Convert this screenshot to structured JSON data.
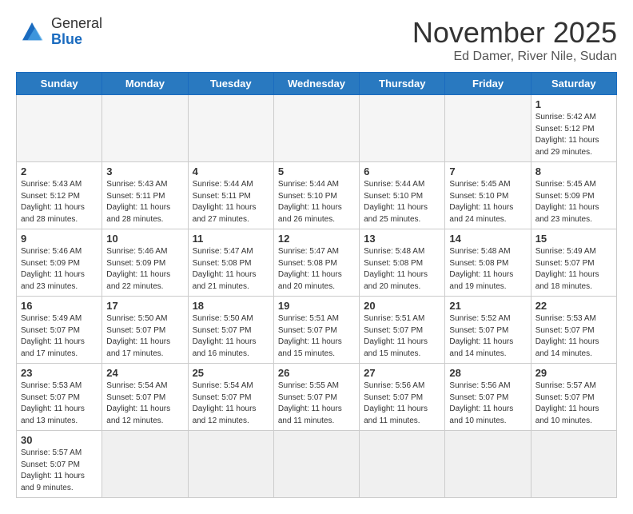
{
  "logo": {
    "text_general": "General",
    "text_blue": "Blue"
  },
  "header": {
    "month": "November 2025",
    "location": "Ed Damer, River Nile, Sudan"
  },
  "days_of_week": [
    "Sunday",
    "Monday",
    "Tuesday",
    "Wednesday",
    "Thursday",
    "Friday",
    "Saturday"
  ],
  "weeks": [
    [
      {
        "day": "",
        "info": ""
      },
      {
        "day": "",
        "info": ""
      },
      {
        "day": "",
        "info": ""
      },
      {
        "day": "",
        "info": ""
      },
      {
        "day": "",
        "info": ""
      },
      {
        "day": "",
        "info": ""
      },
      {
        "day": "1",
        "info": "Sunrise: 5:42 AM\nSunset: 5:12 PM\nDaylight: 11 hours\nand 29 minutes."
      }
    ],
    [
      {
        "day": "2",
        "info": "Sunrise: 5:43 AM\nSunset: 5:12 PM\nDaylight: 11 hours\nand 28 minutes."
      },
      {
        "day": "3",
        "info": "Sunrise: 5:43 AM\nSunset: 5:11 PM\nDaylight: 11 hours\nand 28 minutes."
      },
      {
        "day": "4",
        "info": "Sunrise: 5:44 AM\nSunset: 5:11 PM\nDaylight: 11 hours\nand 27 minutes."
      },
      {
        "day": "5",
        "info": "Sunrise: 5:44 AM\nSunset: 5:10 PM\nDaylight: 11 hours\nand 26 minutes."
      },
      {
        "day": "6",
        "info": "Sunrise: 5:44 AM\nSunset: 5:10 PM\nDaylight: 11 hours\nand 25 minutes."
      },
      {
        "day": "7",
        "info": "Sunrise: 5:45 AM\nSunset: 5:10 PM\nDaylight: 11 hours\nand 24 minutes."
      },
      {
        "day": "8",
        "info": "Sunrise: 5:45 AM\nSunset: 5:09 PM\nDaylight: 11 hours\nand 23 minutes."
      }
    ],
    [
      {
        "day": "9",
        "info": "Sunrise: 5:46 AM\nSunset: 5:09 PM\nDaylight: 11 hours\nand 23 minutes."
      },
      {
        "day": "10",
        "info": "Sunrise: 5:46 AM\nSunset: 5:09 PM\nDaylight: 11 hours\nand 22 minutes."
      },
      {
        "day": "11",
        "info": "Sunrise: 5:47 AM\nSunset: 5:08 PM\nDaylight: 11 hours\nand 21 minutes."
      },
      {
        "day": "12",
        "info": "Sunrise: 5:47 AM\nSunset: 5:08 PM\nDaylight: 11 hours\nand 20 minutes."
      },
      {
        "day": "13",
        "info": "Sunrise: 5:48 AM\nSunset: 5:08 PM\nDaylight: 11 hours\nand 20 minutes."
      },
      {
        "day": "14",
        "info": "Sunrise: 5:48 AM\nSunset: 5:08 PM\nDaylight: 11 hours\nand 19 minutes."
      },
      {
        "day": "15",
        "info": "Sunrise: 5:49 AM\nSunset: 5:07 PM\nDaylight: 11 hours\nand 18 minutes."
      }
    ],
    [
      {
        "day": "16",
        "info": "Sunrise: 5:49 AM\nSunset: 5:07 PM\nDaylight: 11 hours\nand 17 minutes."
      },
      {
        "day": "17",
        "info": "Sunrise: 5:50 AM\nSunset: 5:07 PM\nDaylight: 11 hours\nand 17 minutes."
      },
      {
        "day": "18",
        "info": "Sunrise: 5:50 AM\nSunset: 5:07 PM\nDaylight: 11 hours\nand 16 minutes."
      },
      {
        "day": "19",
        "info": "Sunrise: 5:51 AM\nSunset: 5:07 PM\nDaylight: 11 hours\nand 15 minutes."
      },
      {
        "day": "20",
        "info": "Sunrise: 5:51 AM\nSunset: 5:07 PM\nDaylight: 11 hours\nand 15 minutes."
      },
      {
        "day": "21",
        "info": "Sunrise: 5:52 AM\nSunset: 5:07 PM\nDaylight: 11 hours\nand 14 minutes."
      },
      {
        "day": "22",
        "info": "Sunrise: 5:53 AM\nSunset: 5:07 PM\nDaylight: 11 hours\nand 14 minutes."
      }
    ],
    [
      {
        "day": "23",
        "info": "Sunrise: 5:53 AM\nSunset: 5:07 PM\nDaylight: 11 hours\nand 13 minutes."
      },
      {
        "day": "24",
        "info": "Sunrise: 5:54 AM\nSunset: 5:07 PM\nDaylight: 11 hours\nand 12 minutes."
      },
      {
        "day": "25",
        "info": "Sunrise: 5:54 AM\nSunset: 5:07 PM\nDaylight: 11 hours\nand 12 minutes."
      },
      {
        "day": "26",
        "info": "Sunrise: 5:55 AM\nSunset: 5:07 PM\nDaylight: 11 hours\nand 11 minutes."
      },
      {
        "day": "27",
        "info": "Sunrise: 5:56 AM\nSunset: 5:07 PM\nDaylight: 11 hours\nand 11 minutes."
      },
      {
        "day": "28",
        "info": "Sunrise: 5:56 AM\nSunset: 5:07 PM\nDaylight: 11 hours\nand 10 minutes."
      },
      {
        "day": "29",
        "info": "Sunrise: 5:57 AM\nSunset: 5:07 PM\nDaylight: 11 hours\nand 10 minutes."
      }
    ],
    [
      {
        "day": "30",
        "info": "Sunrise: 5:57 AM\nSunset: 5:07 PM\nDaylight: 11 hours\nand 9 minutes."
      },
      {
        "day": "",
        "info": ""
      },
      {
        "day": "",
        "info": ""
      },
      {
        "day": "",
        "info": ""
      },
      {
        "day": "",
        "info": ""
      },
      {
        "day": "",
        "info": ""
      },
      {
        "day": "",
        "info": ""
      }
    ]
  ]
}
